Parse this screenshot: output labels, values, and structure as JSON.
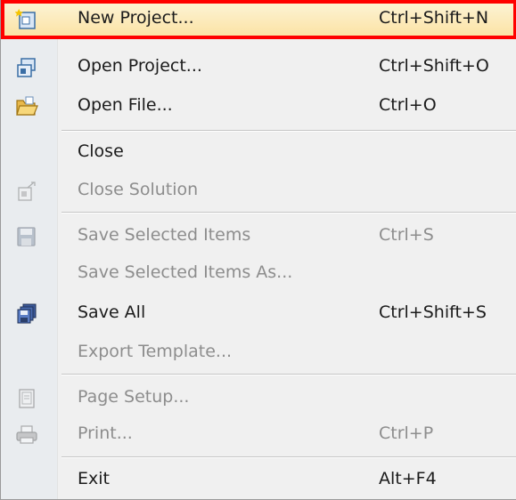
{
  "menu": {
    "items": [
      {
        "label": "New Project...",
        "shortcut": "Ctrl+Shift+N",
        "icon": "new-project-icon",
        "enabled": true,
        "highlighted": true
      },
      {
        "label": "Open Project...",
        "shortcut": "Ctrl+Shift+O",
        "icon": "open-project-icon",
        "enabled": true
      },
      {
        "label": "Open File...",
        "shortcut": "Ctrl+O",
        "icon": "open-folder-icon",
        "enabled": true
      },
      {
        "label": "Close",
        "shortcut": "",
        "icon": "",
        "enabled": true
      },
      {
        "label": "Close Solution",
        "shortcut": "",
        "icon": "close-solution-icon",
        "enabled": false
      },
      {
        "label": "Save Selected Items",
        "shortcut": "Ctrl+S",
        "icon": "save-icon",
        "enabled": false
      },
      {
        "label": "Save Selected Items As...",
        "shortcut": "",
        "icon": "",
        "enabled": false
      },
      {
        "label": "Save All",
        "shortcut": "Ctrl+Shift+S",
        "icon": "save-all-icon",
        "enabled": true
      },
      {
        "label": "Export Template...",
        "shortcut": "",
        "icon": "",
        "enabled": false
      },
      {
        "label": "Page Setup...",
        "shortcut": "",
        "icon": "page-setup-icon",
        "enabled": false
      },
      {
        "label": "Print...",
        "shortcut": "Ctrl+P",
        "icon": "printer-icon",
        "enabled": false
      },
      {
        "label": "Exit",
        "shortcut": "Alt+F4",
        "icon": "",
        "enabled": true
      }
    ]
  },
  "colors": {
    "highlight_border": "#ff0000",
    "menu_background": "#f0f0f0",
    "disabled_text": "#8d8d8d"
  }
}
